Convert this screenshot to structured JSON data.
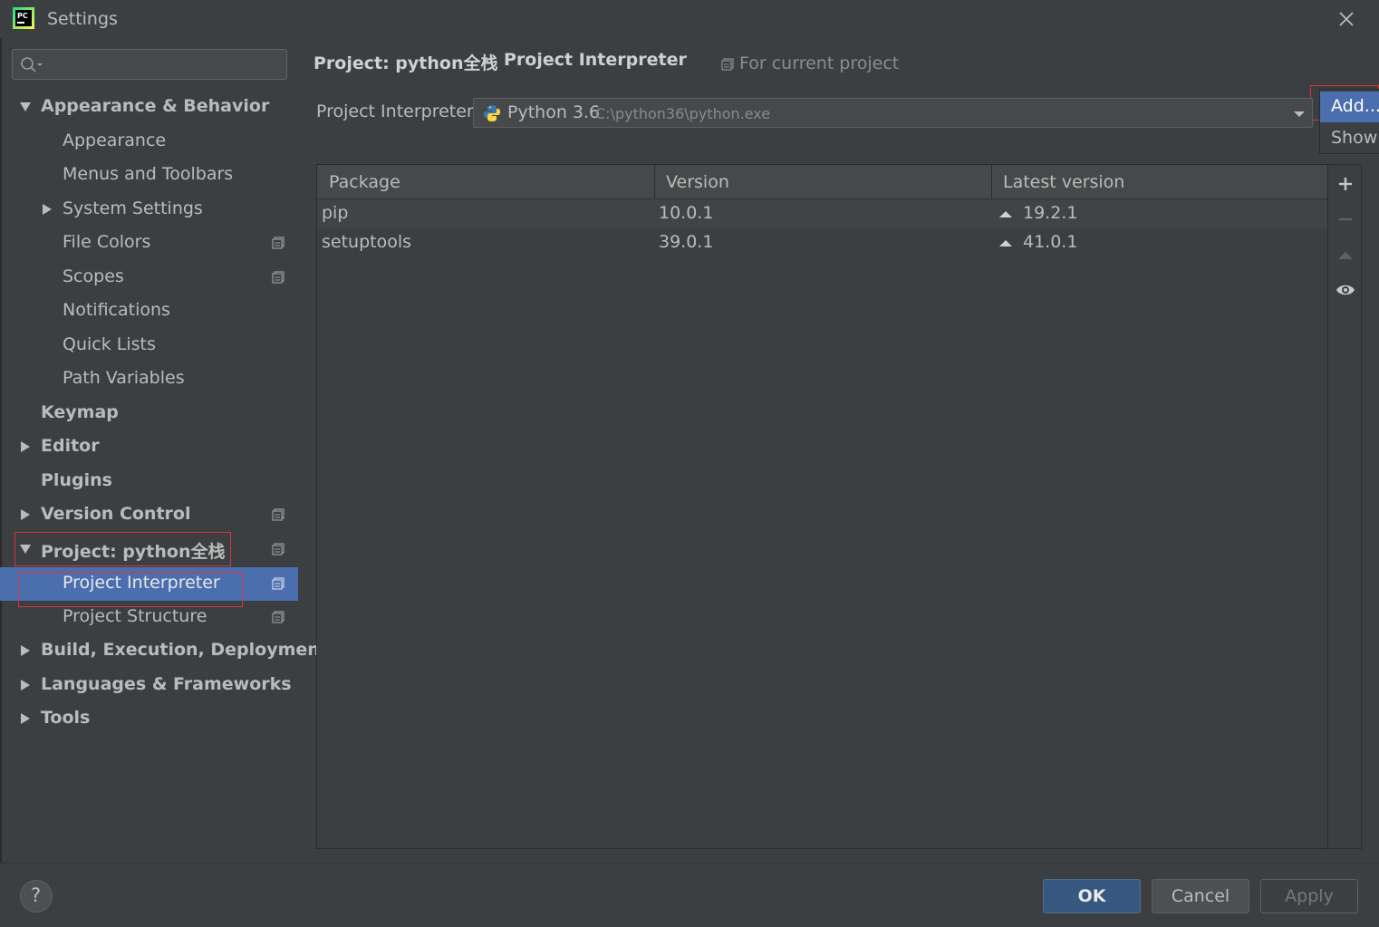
{
  "window": {
    "title": "Settings"
  },
  "search": {
    "value": "",
    "placeholder": ""
  },
  "sidebar": {
    "items": [
      {
        "label": "Appearance & Behavior",
        "bold": true,
        "expanded": true
      },
      {
        "label": "Appearance"
      },
      {
        "label": "Menus and Toolbars"
      },
      {
        "label": "System Settings"
      },
      {
        "label": "File Colors"
      },
      {
        "label": "Scopes"
      },
      {
        "label": "Notifications"
      },
      {
        "label": "Quick Lists"
      },
      {
        "label": "Path Variables"
      },
      {
        "label": "Keymap",
        "bold": true
      },
      {
        "label": "Editor",
        "bold": true
      },
      {
        "label": "Plugins",
        "bold": true
      },
      {
        "label": "Version Control",
        "bold": true
      },
      {
        "label": "Project: python全栈",
        "bold": true,
        "expanded": true
      },
      {
        "label": "Project Interpreter",
        "selected": true
      },
      {
        "label": "Project Structure"
      },
      {
        "label": "Build, Execution, Deployment",
        "bold": true
      },
      {
        "label": "Languages & Frameworks",
        "bold": true
      },
      {
        "label": "Tools",
        "bold": true
      }
    ]
  },
  "breadcrumb": {
    "project": "Project: python全栈",
    "separator": "›",
    "page": "Project Interpreter"
  },
  "scope_note": "For current project",
  "interpreter": {
    "label": "Project Interpreter:",
    "name": "Python 3.6",
    "path": "C:\\python36\\python.exe"
  },
  "popup_menu": {
    "add": "Add...",
    "show": "Show All..."
  },
  "packages": {
    "columns": [
      "Package",
      "Version",
      "Latest version"
    ],
    "rows": [
      {
        "name": "pip",
        "version": "10.0.1",
        "latest": "19.2.1"
      },
      {
        "name": "setuptools",
        "version": "39.0.1",
        "latest": "41.0.1"
      }
    ]
  },
  "footer": {
    "help": "?",
    "ok": "OK",
    "cancel": "Cancel",
    "apply": "Apply"
  },
  "colors": {
    "background": "#3c3f41",
    "selection": "#4b6eaf",
    "ok_button": "#365880",
    "highlight_box": "#d3373e"
  },
  "icons": {
    "app": "pycharm-logo-icon",
    "close": "close-icon",
    "search": "search-icon",
    "scope": "project-scope-icon",
    "python": "python-logo-icon",
    "add": "plus-icon",
    "remove": "minus-icon",
    "upgrade": "upgrade-triangle-icon",
    "show_early": "eye-icon"
  }
}
